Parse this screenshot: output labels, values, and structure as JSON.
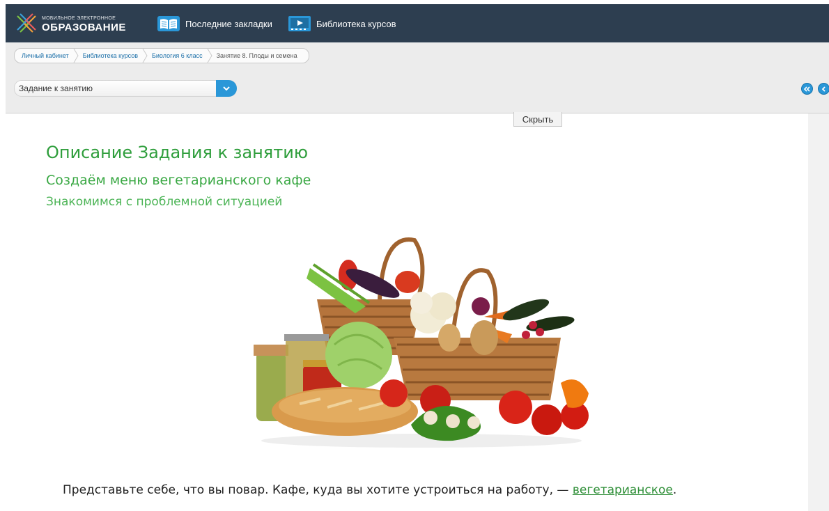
{
  "header": {
    "logo_small": "МОБИЛЬНОЕ ЭЛЕКТРОННОЕ",
    "logo_big": "ОБРАЗОВАНИЕ",
    "nav": [
      {
        "label": "Последние закладки",
        "icon": "open-book-icon"
      },
      {
        "label": "Библиотека курсов",
        "icon": "video-library-icon"
      }
    ],
    "color": "#2d3e50"
  },
  "breadcrumb": [
    "Личный кабинет",
    "Библиотека курсов",
    "Биология 6 класс",
    "Занятие 8. Плоды и семена"
  ],
  "section_select": {
    "value": "Задание к занятию"
  },
  "hide_button": "Скрыть",
  "content": {
    "title": "Описание Задания к занятию",
    "subtitle": "Создаём меню вегетарианского кафе",
    "section": "Знакомимся с проблемной ситуацией",
    "paragraph_before": "Представьте себе, что вы повар. Кафе, куда вы хотите устроиться на работу, — ",
    "paragraph_link": "вегетарианское",
    "paragraph_after": "."
  },
  "colors": {
    "accent": "#2a97d8",
    "heading_green": "#2f9e3c",
    "link_green": "#2f8f38"
  }
}
